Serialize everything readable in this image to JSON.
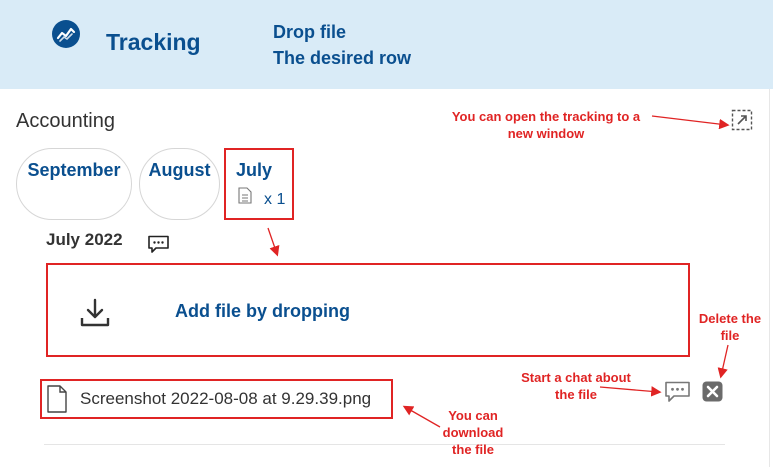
{
  "header": {
    "app_title": "Tracking",
    "line1": "Drop file",
    "line2": "The desired row"
  },
  "section": {
    "title": "Accounting"
  },
  "months": [
    {
      "label": "September"
    },
    {
      "label": "August"
    },
    {
      "label": "July",
      "file_count": "x 1",
      "selected": true
    }
  ],
  "period": {
    "title": "July 2022"
  },
  "dropzone": {
    "label": "Add file by dropping"
  },
  "file": {
    "name": "Screenshot 2022-08-08 at 9.29.39.png"
  },
  "annotations": {
    "open_window": [
      "You can open the tracking to a",
      "new window"
    ],
    "delete_file": [
      "Delete the",
      "file"
    ],
    "start_chat": [
      "Start a chat about",
      "the file"
    ],
    "download": [
      "You can",
      "download",
      "the file"
    ]
  },
  "colors": {
    "brand": "#0a4f8f",
    "header_bg": "#d9ebf7",
    "annotation_red": "#e02424"
  },
  "icons": [
    "trending-icon",
    "open-window-icon",
    "document-icon",
    "chat-icon",
    "download-icon",
    "delete-icon"
  ]
}
